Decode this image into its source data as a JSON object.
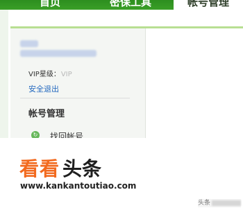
{
  "nav": {
    "tabs": [
      {
        "label": "首页"
      },
      {
        "label": "密保工具"
      },
      {
        "label": "帐号管理"
      }
    ]
  },
  "account": {
    "vip_label": "VIP星级：",
    "vip_value": "VIP",
    "logout": "安全退出"
  },
  "section": {
    "title": "帐号管理",
    "items": [
      {
        "label": "找回帐号",
        "icon": "recover-icon"
      }
    ]
  },
  "watermark": {
    "brand_left": "看看",
    "brand_right": "头条",
    "url": "www.kankantoutiao.com",
    "corner_prefix": "头条"
  },
  "colors": {
    "nav_green": "#2d8e1f",
    "link_blue": "#2469bf",
    "watermark_orange": "#f26a1f"
  }
}
